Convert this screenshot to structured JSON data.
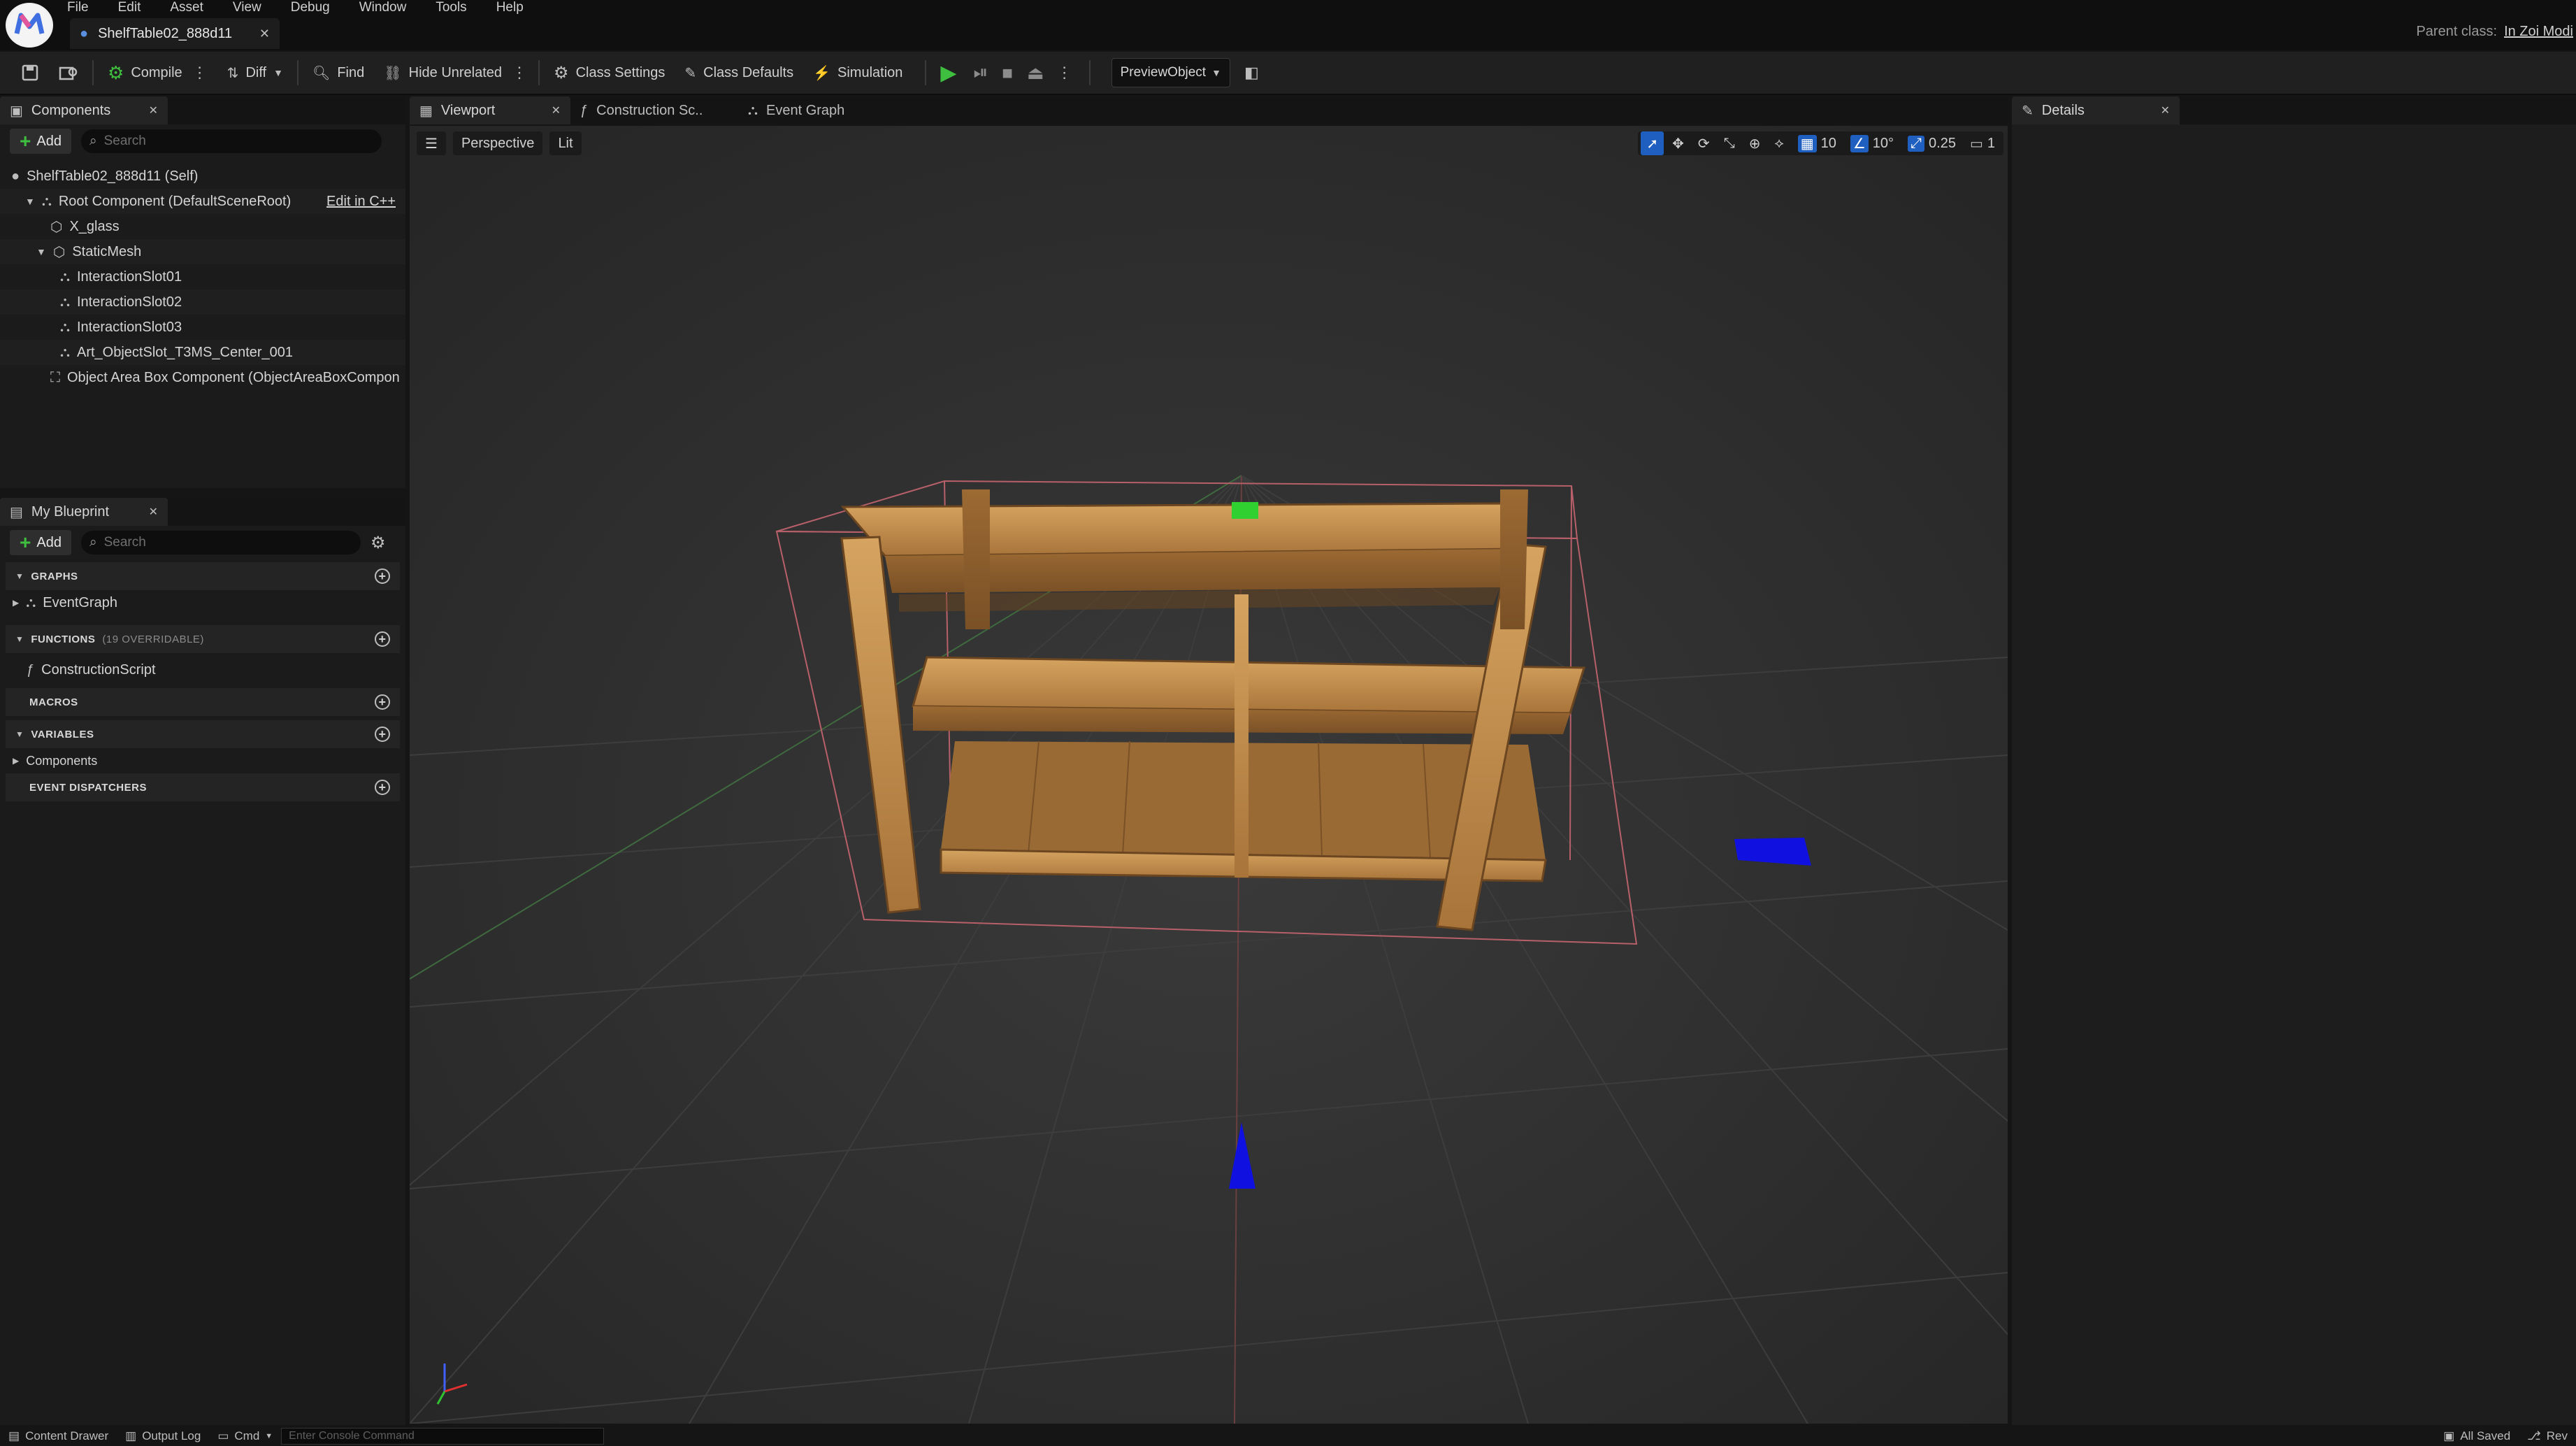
{
  "app": {
    "menu": [
      "File",
      "Edit",
      "Asset",
      "View",
      "Debug",
      "Window",
      "Tools",
      "Help"
    ],
    "document_tab": "ShelfTable02_888d11",
    "parent_class_label": "Parent class:",
    "parent_class_value": "In Zoi Modi"
  },
  "toolbar": {
    "compile": "Compile",
    "diff": "Diff",
    "find": "Find",
    "hide_unrelated": "Hide Unrelated",
    "class_settings": "Class Settings",
    "class_defaults": "Class Defaults",
    "simulation": "Simulation",
    "preview_object": "PreviewObject"
  },
  "components_panel": {
    "tab": "Components",
    "add": "Add",
    "search_placeholder": "Search",
    "items": [
      {
        "label": "ShelfTable02_888d11 (Self)",
        "depth": 0
      },
      {
        "label": "Root Component (DefaultSceneRoot)",
        "depth": 1,
        "action": "Edit in C++"
      },
      {
        "label": "X_glass",
        "depth": 2
      },
      {
        "label": "StaticMesh",
        "depth": 2
      },
      {
        "label": "InteractionSlot01",
        "depth": 3
      },
      {
        "label": "InteractionSlot02",
        "depth": 3
      },
      {
        "label": "InteractionSlot03",
        "depth": 3
      },
      {
        "label": "Art_ObjectSlot_T3MS_Center_001",
        "depth": 3
      },
      {
        "label": "Object Area Box Component (ObjectAreaBoxCompon",
        "depth": 2
      }
    ]
  },
  "blueprint_panel": {
    "tab": "My Blueprint",
    "add": "Add",
    "search_placeholder": "Search",
    "graphs": "GRAPHS",
    "event_graph": "EventGraph",
    "functions": "FUNCTIONS",
    "functions_sub": "(19 OVERRIDABLE)",
    "construction_script": "ConstructionScript",
    "macros": "MACROS",
    "variables": "VARIABLES",
    "components": "Components",
    "event_dispatchers": "EVENT DISPATCHERS"
  },
  "center_tabs": [
    "Viewport",
    "Construction Sc..",
    "Event Graph"
  ],
  "viewport": {
    "perspective": "Perspective",
    "lit": "Lit",
    "grid_snap": "10",
    "rotation_snap": "10°",
    "scale_snap": "0.25",
    "camera_speed": "1"
  },
  "details_panel": {
    "tab": "Details"
  },
  "bottom_bar": {
    "content_drawer": "Content Drawer",
    "output_log": "Output Log",
    "cmd": "Cmd",
    "console_placeholder": "Enter Console Command",
    "all_saved": "All Saved",
    "revision": "Rev"
  },
  "colors": {
    "accent_green": "#3fbf3f",
    "selection_blue": "#1f5fbf",
    "bounds_pink": "#c0606a",
    "wood": "#b07c3a"
  }
}
